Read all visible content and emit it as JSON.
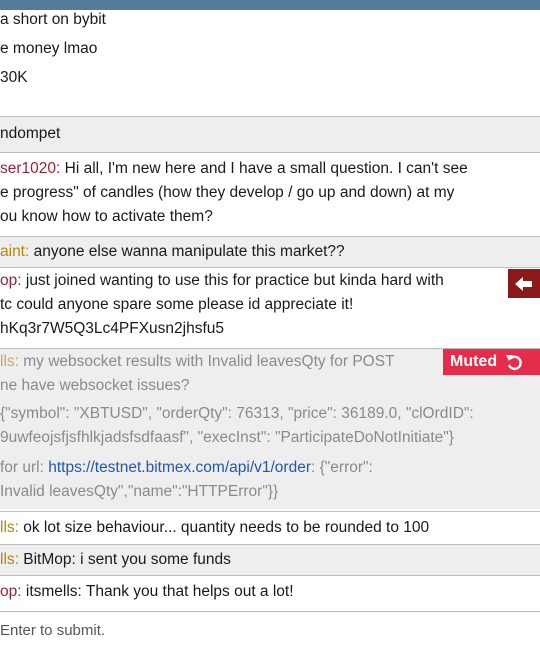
{
  "messages": {
    "m1": {
      "lines": [
        "a short on bybit",
        "e money lmao",
        " 30K"
      ]
    },
    "m2": {
      "text": "ndompet"
    },
    "m3": {
      "user": "ser1020:",
      "user_color": "#9b2335",
      "lines": [
        " Hi all, I'm new here and I have a small question. I can't see",
        "e progress\" of candles (how they develop / go up and down) at my",
        "ou know how to activate them?"
      ]
    },
    "m4": {
      "user": "aint:",
      "user_color": "#b8860b",
      "text": " anyone else wanna manipulate this market??"
    },
    "m5": {
      "user": "op:",
      "user_color": "#9b2335",
      "lines": [
        " just joined wanting to use this for practice but kinda hard with",
        "tc could anyone spare some please id appreciate it!",
        "hKq3r7W5Q3Lc4PFXusn2jhsfu5"
      ],
      "kick_icon": "arrow-left-icon"
    },
    "m6": {
      "user": "lls:",
      "user_color": "#c9a56b",
      "line1": " my websocket results with Invalid leavesQty for POST",
      "line2": "ne have websocket issues?",
      "json1": "{\"symbol\": \"XBTUSD\", \"orderQty\": 76313, \"price\": 36189.0, \"clOrdID\":",
      "json2": "9uwfeojsfjsfhlkjadsfsdfaasf\", \"execInst\": \"ParticipateDoNotInitiate\"}",
      "url_prefix": " for url: ",
      "url": "https://testnet.bitmex.com/api/v1/order",
      "url_suffix": ": {\"error\":",
      "json3": "Invalid leavesQty\",\"name\":\"HTTPError\"}}",
      "badge_label": "Muted",
      "badge_icon": "undo-icon"
    },
    "m7": {
      "user": "lls:",
      "user_color": "#b8860b",
      "text": " ok lot size behaviour... quantity needs to be rounded to 100"
    },
    "m8": {
      "user": "lls:",
      "user_color": "#b8860b",
      "text": " BitMop: i sent you some funds"
    },
    "m9": {
      "user": "op:",
      "user_color": "#9b2335",
      "text": " itsmells: Thank you that helps out a lot!"
    }
  },
  "input": {
    "hint": " Enter to submit."
  },
  "colors": {
    "topbar": "#557a9b",
    "muted_badge": "#e52d4b",
    "kick_button": "#8b1a1a",
    "link": "#1f57b5"
  }
}
